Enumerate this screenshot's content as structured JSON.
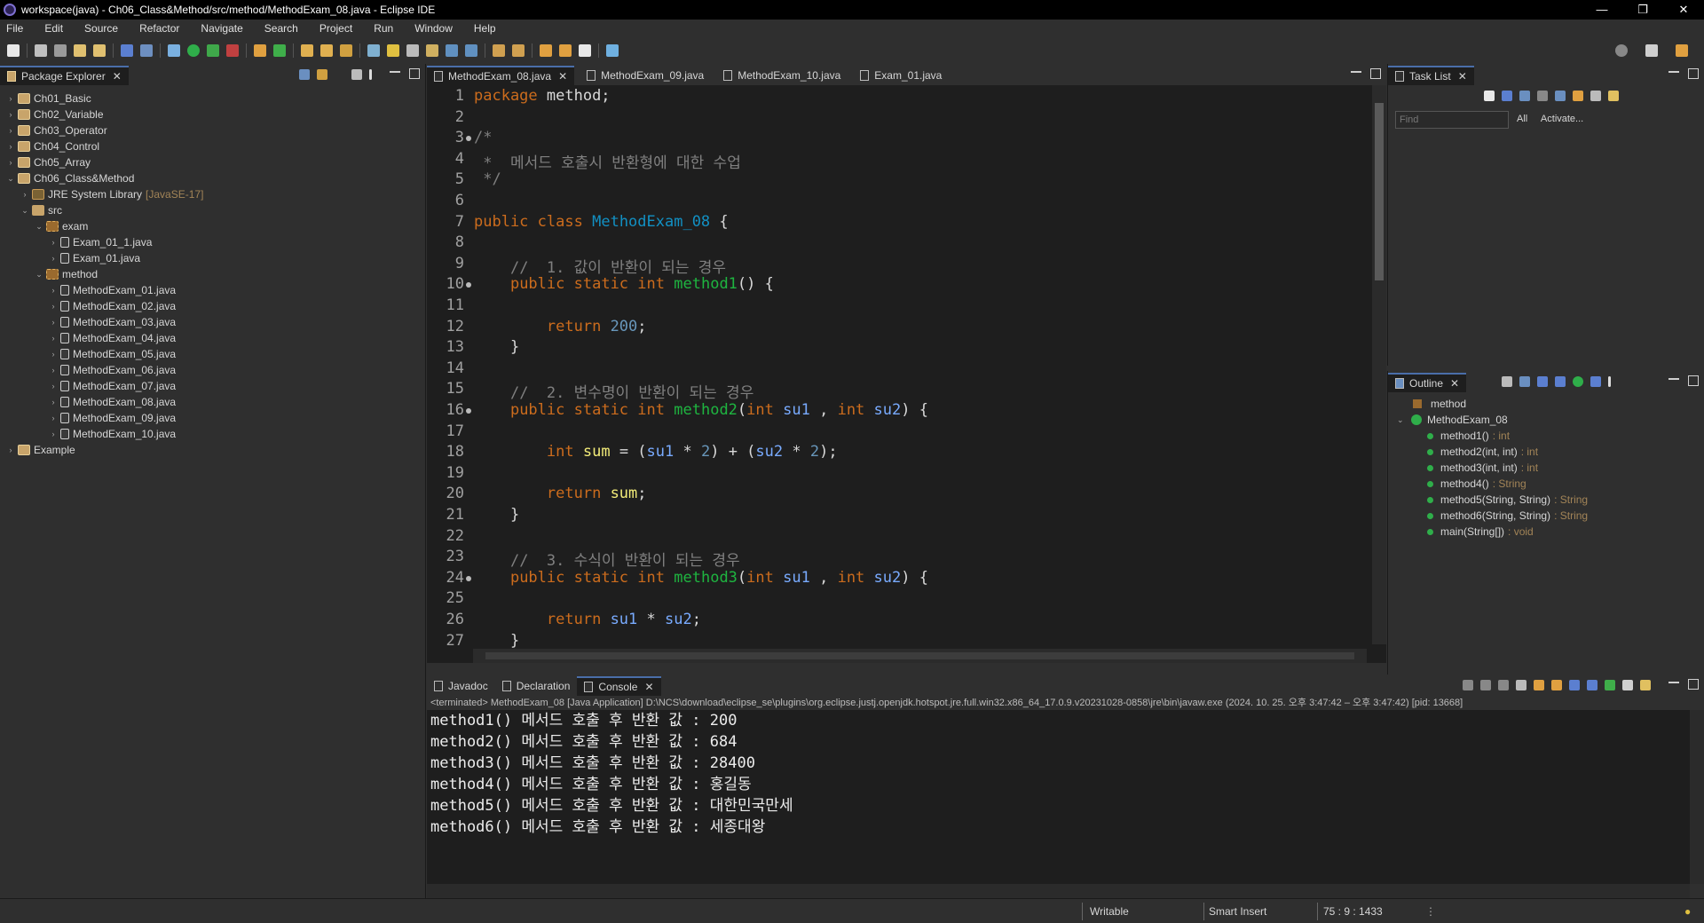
{
  "window": {
    "title": "workspace(java) - Ch06_Class&Method/src/method/MethodExam_08.java - Eclipse IDE",
    "controls": [
      "—",
      "❐",
      "✕"
    ]
  },
  "menu": [
    "File",
    "Edit",
    "Source",
    "Refactor",
    "Navigate",
    "Search",
    "Project",
    "Run",
    "Window",
    "Help"
  ],
  "package_explorer": {
    "title": "Package Explorer",
    "items": [
      {
        "label": "Ch01_Basic",
        "level": 0,
        "kind": "proj",
        "arrow": "›"
      },
      {
        "label": "Ch02_Variable",
        "level": 0,
        "kind": "proj",
        "arrow": "›"
      },
      {
        "label": "Ch03_Operator",
        "level": 0,
        "kind": "proj",
        "arrow": "›"
      },
      {
        "label": "Ch04_Control",
        "level": 0,
        "kind": "proj",
        "arrow": "›"
      },
      {
        "label": "Ch05_Array",
        "level": 0,
        "kind": "proj",
        "arrow": "›"
      },
      {
        "label": "Ch06_Class&Method",
        "level": 0,
        "kind": "proj",
        "arrow": "⌄"
      },
      {
        "label": "JRE System Library",
        "level": 1,
        "kind": "lib",
        "arrow": "›",
        "extra": "[JavaSE-17]"
      },
      {
        "label": "src",
        "level": 1,
        "kind": "src",
        "arrow": "⌄"
      },
      {
        "label": "exam",
        "level": 2,
        "kind": "pkgi",
        "arrow": "⌄"
      },
      {
        "label": "Exam_01_1.java",
        "level": 3,
        "kind": "java",
        "arrow": "›"
      },
      {
        "label": "Exam_01.java",
        "level": 3,
        "kind": "java",
        "arrow": "›"
      },
      {
        "label": "method",
        "level": 2,
        "kind": "pkgi",
        "arrow": "⌄"
      },
      {
        "label": "MethodExam_01.java",
        "level": 3,
        "kind": "java",
        "arrow": "›"
      },
      {
        "label": "MethodExam_02.java",
        "level": 3,
        "kind": "java",
        "arrow": "›"
      },
      {
        "label": "MethodExam_03.java",
        "level": 3,
        "kind": "java",
        "arrow": "›"
      },
      {
        "label": "MethodExam_04.java",
        "level": 3,
        "kind": "java",
        "arrow": "›"
      },
      {
        "label": "MethodExam_05.java",
        "level": 3,
        "kind": "java",
        "arrow": "›"
      },
      {
        "label": "MethodExam_06.java",
        "level": 3,
        "kind": "java",
        "arrow": "›"
      },
      {
        "label": "MethodExam_07.java",
        "level": 3,
        "kind": "java",
        "arrow": "›"
      },
      {
        "label": "MethodExam_08.java",
        "level": 3,
        "kind": "java",
        "arrow": "›"
      },
      {
        "label": "MethodExam_09.java",
        "level": 3,
        "kind": "java",
        "arrow": "›"
      },
      {
        "label": "MethodExam_10.java",
        "level": 3,
        "kind": "java",
        "arrow": "›"
      },
      {
        "label": "Example",
        "level": 0,
        "kind": "proj",
        "arrow": "›"
      }
    ]
  },
  "editor": {
    "tabs": [
      {
        "label": "MethodExam_08.java",
        "active": true
      },
      {
        "label": "MethodExam_09.java",
        "active": false
      },
      {
        "label": "MethodExam_10.java",
        "active": false
      },
      {
        "label": "Exam_01.java",
        "active": false
      }
    ],
    "lines": [
      {
        "n": "1",
        "html": "<span class='kw'>package</span> method;"
      },
      {
        "n": "2",
        "html": ""
      },
      {
        "n": "3",
        "fold": true,
        "html": "<span class='cm'>/*</span>"
      },
      {
        "n": "4",
        "html": "<span class='cm'> *  메서드 호출시 반환형에 대한 수업</span>"
      },
      {
        "n": "5",
        "html": "<span class='cm'> */</span>"
      },
      {
        "n": "6",
        "html": ""
      },
      {
        "n": "7",
        "html": "<span class='kw'>public</span> <span class='kw'>class</span> <span class='cls'>MethodExam_08</span> {"
      },
      {
        "n": "8",
        "html": ""
      },
      {
        "n": "9",
        "html": "    <span class='cm'>//  1. 값이 반환이 되는 경우</span>"
      },
      {
        "n": "10",
        "fold": true,
        "html": "    <span class='kw'>public</span> <span class='kw'>static</span> <span class='kw'>int</span> <span class='mth'>method1</span>() {"
      },
      {
        "n": "11",
        "html": ""
      },
      {
        "n": "12",
        "html": "        <span class='kw'>return</span> <span class='num'>200</span>;"
      },
      {
        "n": "13",
        "html": "    }"
      },
      {
        "n": "14",
        "html": ""
      },
      {
        "n": "15",
        "html": "    <span class='cm'>//  2. 변수명이 반환이 되는 경우</span>"
      },
      {
        "n": "16",
        "fold": true,
        "html": "    <span class='kw'>public</span> <span class='kw'>static</span> <span class='kw'>int</span> <span class='mth'>method2</span>(<span class='kw'>int</span> <span class='var'>su1</span> , <span class='kw'>int</span> <span class='var'>su2</span>) {"
      },
      {
        "n": "17",
        "html": ""
      },
      {
        "n": "18",
        "html": "        <span class='kw'>int</span> <span class='var' style='color:#f3ec79'>sum</span> = (<span class='var'>su1</span> * <span class='num'>2</span>) + (<span class='var'>su2</span> * <span class='num'>2</span>);"
      },
      {
        "n": "19",
        "html": ""
      },
      {
        "n": "20",
        "html": "        <span class='kw'>return</span> <span style='color:#f3ec79'>sum</span>;"
      },
      {
        "n": "21",
        "html": "    }"
      },
      {
        "n": "22",
        "html": ""
      },
      {
        "n": "23",
        "html": "    <span class='cm'>//  3. 수식이 반환이 되는 경우</span>"
      },
      {
        "n": "24",
        "fold": true,
        "html": "    <span class='kw'>public</span> <span class='kw'>static</span> <span class='kw'>int</span> <span class='mth'>method3</span>(<span class='kw'>int</span> <span class='var'>su1</span> , <span class='kw'>int</span> <span class='var'>su2</span>) {"
      },
      {
        "n": "25",
        "html": ""
      },
      {
        "n": "26",
        "html": "        <span class='kw'>return</span> <span class='var'>su1</span> * <span class='var'>su2</span>;"
      },
      {
        "n": "27",
        "html": "    }"
      }
    ]
  },
  "task_list": {
    "title": "Task List",
    "find_placeholder": "Find",
    "filter_all": "All",
    "filter_activate": "Activate..."
  },
  "outline": {
    "title": "Outline",
    "package": "method",
    "class": "MethodExam_08",
    "members": [
      {
        "name": "method1()",
        "type": ": int"
      },
      {
        "name": "method2(int, int)",
        "type": ": int"
      },
      {
        "name": "method3(int, int)",
        "type": ": int"
      },
      {
        "name": "method4()",
        "type": ": String"
      },
      {
        "name": "method5(String, String)",
        "type": ": String"
      },
      {
        "name": "method6(String, String)",
        "type": ": String"
      },
      {
        "name": "main(String[])",
        "type": ": void"
      }
    ]
  },
  "console": {
    "tabs": [
      {
        "label": "Javadoc",
        "active": false
      },
      {
        "label": "Declaration",
        "active": false
      },
      {
        "label": "Console",
        "active": true
      }
    ],
    "terminated": "<terminated> MethodExam_08 [Java Application] D:\\NCS\\download\\eclipse_se\\plugins\\org.eclipse.justj.openjdk.hotspot.jre.full.win32.x86_64_17.0.9.v20231028-0858\\jre\\bin\\javaw.exe  (2024. 10. 25. 오후 3:47:42 – 오후 3:47:42) [pid: 13668]",
    "lines": [
      "method1() 메서드 호출 후 반환 값 : 200",
      "method2() 메서드 호출 후 반환 값 : 684",
      "method3() 메서드 호출 후 반환 값 : 28400",
      "method4() 메서드 호출 후 반환 값 : 홍길동",
      "method5() 메서드 호출 후 반환 값 : 대한민국만세",
      "method6() 메서드 호출 후 반환 값 : 세종대왕"
    ]
  },
  "status": {
    "writable": "Writable",
    "insert_mode": "Smart Insert",
    "position": "75 : 9 : 1433"
  },
  "colors": {
    "accent": "#4a6ea9",
    "keyword": "#cc6c1d",
    "comment": "#808080",
    "class": "#1290c3",
    "method": "#1eb540",
    "variable": "#79abff"
  }
}
